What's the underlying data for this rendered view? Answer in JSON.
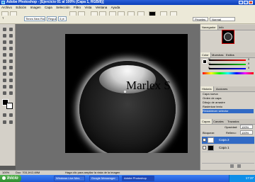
{
  "window": {
    "title": "Adobe Photoshop - [Ejercicio 01 al 100% (Capa 1, RGB/8)]",
    "controls": [
      "_",
      "□",
      "×"
    ]
  },
  "menu": [
    "Archivo",
    "Edición",
    "Imagen",
    "Capa",
    "Selección",
    "Filtro",
    "Vista",
    "Ventana",
    "Ayuda"
  ],
  "options_bar": {
    "font_family": "Times New Roman",
    "font_style": "Regular",
    "font_size": "4 pt",
    "brushes_tab": "Pinceles",
    "brushes_mode": "Normal",
    "color_swatch": "#000000"
  },
  "document": {
    "text": "Marlex S",
    "background": "#000000"
  },
  "panels": {
    "navigator": {
      "tabs": [
        "Navegador",
        "Info"
      ]
    },
    "color": {
      "tabs": [
        "Color",
        "Muestras",
        "Estilos"
      ],
      "sliders": [
        {
          "label": "R",
          "value": "0"
        },
        {
          "label": "G",
          "value": "0"
        },
        {
          "label": "B",
          "value": "0"
        }
      ]
    },
    "history": {
      "tabs": [
        "Historia",
        "Acciones"
      ],
      "items": [
        "Capa nueva",
        "Orden de capa",
        "Dibujo de arrastre",
        "Rasterizar texto",
        "Restablecer selector"
      ],
      "selected_index": 4
    },
    "layers": {
      "tabs": [
        "Capas",
        "Canales",
        "Trazados"
      ],
      "opacity_label": "Opacidad:",
      "opacity_value": "100%",
      "lock_label": "Bloquear:",
      "fill_label": "Relleno:",
      "fill_value": "100%",
      "items": [
        {
          "name": "Capa 2",
          "selected": true
        },
        {
          "name": "Capa 1",
          "selected": false
        }
      ]
    }
  },
  "status": {
    "zoom": "100%",
    "doc_size": "Doc: 703,1K/2,69M",
    "hint": "Haga clic para ampliar la vista de la imagen"
  },
  "taskbar": {
    "start_label": "Inicio",
    "tasks": [
      "Windows Live Mes",
      "Google Messenger",
      "Adobe Photoshop"
    ],
    "active_task_index": 2,
    "clock": "17:37"
  }
}
